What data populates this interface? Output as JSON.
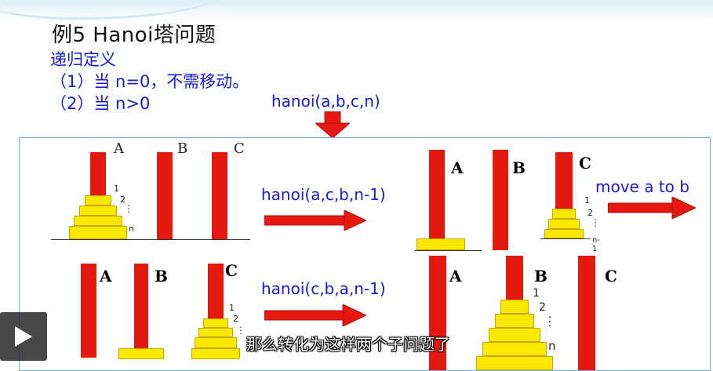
{
  "slide": {
    "title": "例5  Hanoi塔问题",
    "subtitle": "递归定义",
    "rule1": "（1）当 n=0，不需移动。",
    "rule2": "（2）当 n>0",
    "main_call": "hanoi(a,b,c,n)"
  },
  "steps": {
    "step1_call": "hanoi(a,c,b,n-1)",
    "step2_call": "move a to b",
    "step3_call": "hanoi(c,b,a,n-1)"
  },
  "pegs": {
    "a_lower": "A",
    "b_lower": "B",
    "c_lower": "C",
    "a": "A",
    "b": "B",
    "c": "C"
  },
  "disk_labels": {
    "one": "1",
    "two": "2",
    "n": "n",
    "n_minus_1": "n-1"
  },
  "colors": {
    "peg": "#e5190f",
    "disk": "#fbe800",
    "label_blue": "#1a1ad6",
    "arrow": "#e5190f"
  },
  "video": {
    "caption": "那么转化为这样两个子问题了",
    "play_icon": "play-icon"
  }
}
